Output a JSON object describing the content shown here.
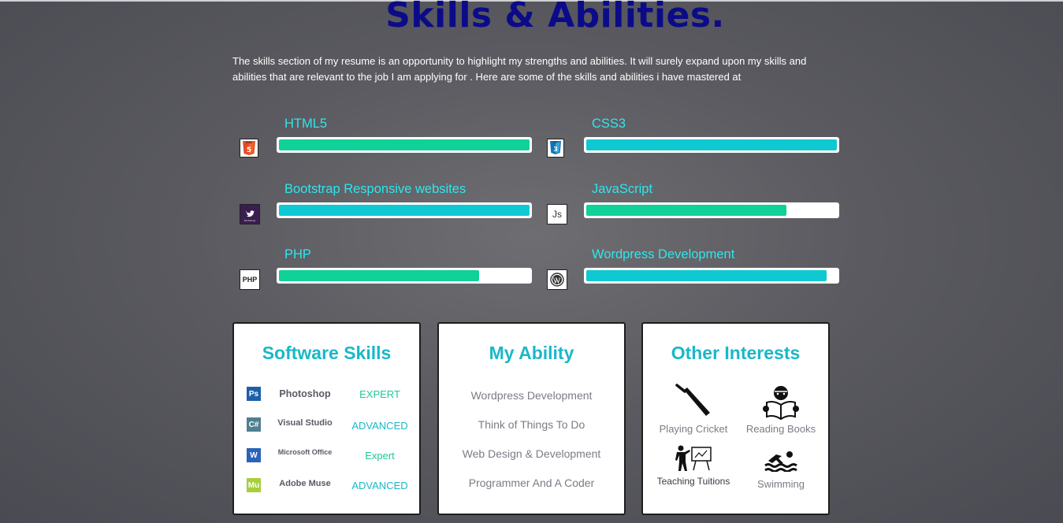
{
  "header": {
    "title": "Skills & Abilities.",
    "intro": "The skills section of my resume is an opportunity to highlight my strengths and abilities. It will surely expand upon my skills and abilities that are relevant to the job I am applying for . Here are some of the skills and abilities i have mastered at"
  },
  "skills": [
    {
      "name": "HTML5",
      "icon": "html5-icon",
      "level": 1.0,
      "color": "#10d198"
    },
    {
      "name": "CSS3",
      "icon": "css3-icon",
      "level": 1.0,
      "color": "#0fc9d2"
    },
    {
      "name": "Bootstrap Responsive websites",
      "icon": "bootstrap-icon",
      "level": 1.0,
      "color": "#0fc9d2"
    },
    {
      "name": "JavaScript",
      "icon": "javascript-icon",
      "level": 0.8,
      "color": "#10d198"
    },
    {
      "name": "PHP",
      "icon": "php-icon",
      "level": 0.8,
      "color": "#10d198"
    },
    {
      "name": "Wordpress Development",
      "icon": "wordpress-icon",
      "level": 0.96,
      "color": "#0fc9d2"
    }
  ],
  "icon_text": {
    "html": "HTML",
    "css": "CSS",
    "js": "Js",
    "php": "PHP",
    "boot": "Bootstrap"
  },
  "software": {
    "title": "Software Skills",
    "items": [
      {
        "name": "Photoshop",
        "level": "EXPERT",
        "badge": "Ps",
        "badge_color": "#1d5fa8",
        "level_color": "#1ec99a"
      },
      {
        "name": "Visual Studio",
        "level": "ADVANCED",
        "badge": "C#",
        "badge_color": "#4f7f91",
        "level_color": "#19b8c7"
      },
      {
        "name": "Microsoft Office",
        "level": "Expert",
        "badge": "W",
        "badge_color": "#2b63b8",
        "level_color": "#1ec99a"
      },
      {
        "name": "Adobe Muse",
        "level": "ADVANCED",
        "badge": "Mu",
        "badge_color": "#a6cf3a",
        "level_color": "#19b8c7"
      }
    ]
  },
  "ability": {
    "title": "My Ability",
    "items": [
      "Wordpress Development",
      "Think of Things To Do",
      "Web Design & Development",
      "Programmer And A Coder"
    ]
  },
  "interests": {
    "title": "Other Interests",
    "items": [
      {
        "name": "Playing Cricket",
        "icon": "cricket-bat-icon"
      },
      {
        "name": "Reading Books",
        "icon": "reading-icon"
      },
      {
        "name": "Teaching Tuitions",
        "icon": "teaching-icon"
      },
      {
        "name": "Swimming",
        "icon": "swimming-icon"
      }
    ]
  },
  "colors": {
    "title": "#0b0b8a",
    "skill_label": "#2fe6ec",
    "card_heading": "#19b8c7"
  }
}
